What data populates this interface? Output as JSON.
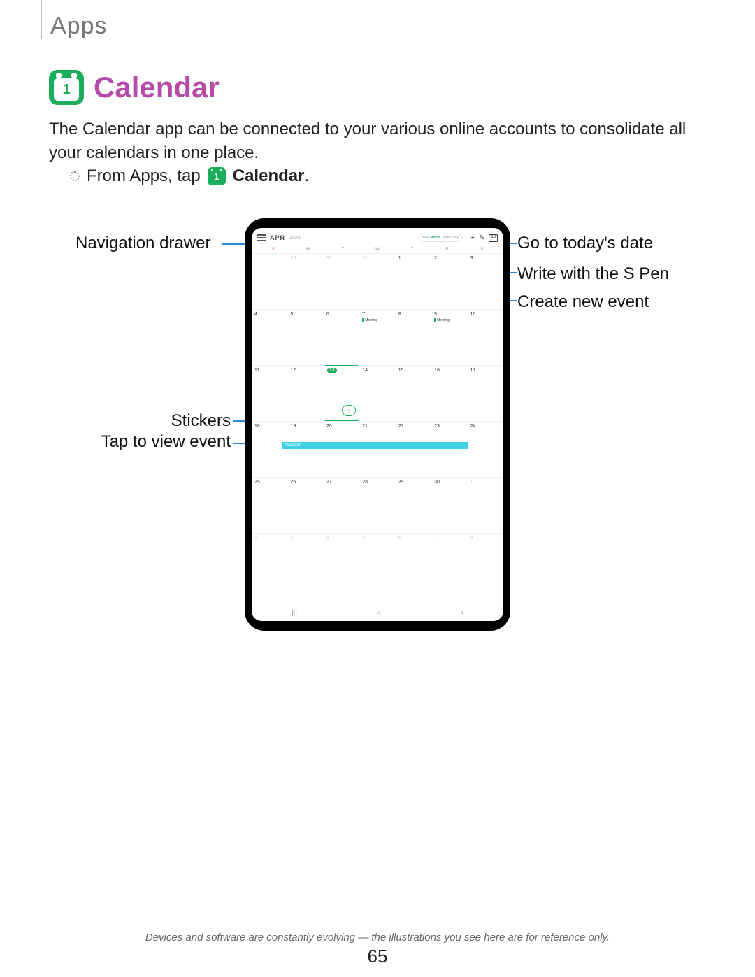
{
  "section": "Apps",
  "title": "Calendar",
  "intro": "The Calendar app can be connected to your various online accounts to consolidate all your calendars in one place.",
  "step_prefix": "From Apps, tap",
  "step_app": "Calendar",
  "step_period": ".",
  "callouts": {
    "nav_drawer": "Navigation drawer",
    "today": "Go to today's date",
    "spen": "Write with the S Pen",
    "new_event": "Create new event",
    "stickers": "Stickers",
    "view_event": "Tap to view event"
  },
  "calendar_screen": {
    "hamburger": "≡",
    "month": "APR",
    "year": "2020",
    "view_tabs": {
      "year": "Year",
      "month": "Month",
      "week": "Week",
      "day": "Day"
    },
    "icons": {
      "plus": "+",
      "pen": "✎",
      "today": "13"
    },
    "dow": [
      "S",
      "M",
      "T",
      "W",
      "T",
      "F",
      "S"
    ],
    "event_label": "Meeting",
    "vacation_label": "Vacation",
    "today_num": "13",
    "cells": [
      {
        "n": "",
        "dim": true
      },
      {
        "n": "29",
        "dim": true
      },
      {
        "n": "30",
        "dim": true
      },
      {
        "n": "31",
        "dim": true
      },
      {
        "n": "1"
      },
      {
        "n": "2"
      },
      {
        "n": "3"
      },
      {
        "n": "4"
      },
      {
        "n": "5"
      },
      {
        "n": "6"
      },
      {
        "n": "7",
        "ev": true
      },
      {
        "n": "8"
      },
      {
        "n": "9",
        "ev": true
      },
      {
        "n": "10"
      },
      {
        "n": "11"
      },
      {
        "n": "12"
      },
      {
        "n": "13",
        "today": true
      },
      {
        "n": "14"
      },
      {
        "n": "15"
      },
      {
        "n": "16"
      },
      {
        "n": "17"
      },
      {
        "n": "18"
      },
      {
        "n": "19"
      },
      {
        "n": "20"
      },
      {
        "n": "21"
      },
      {
        "n": "22"
      },
      {
        "n": "23"
      },
      {
        "n": "24"
      },
      {
        "n": "25"
      },
      {
        "n": "26"
      },
      {
        "n": "27"
      },
      {
        "n": "28"
      },
      {
        "n": "29"
      },
      {
        "n": "30"
      },
      {
        "n": "1",
        "dim": true
      },
      {
        "n": "2",
        "dim": true
      },
      {
        "n": "3",
        "dim": true
      },
      {
        "n": "4",
        "dim": true
      },
      {
        "n": "5",
        "dim": true
      },
      {
        "n": "6",
        "dim": true
      },
      {
        "n": "7",
        "dim": true
      },
      {
        "n": "8",
        "dim": true
      }
    ],
    "nav": {
      "recent": "|||",
      "home": "○",
      "back": "‹"
    }
  },
  "footer": "Devices and software are constantly evolving — the illustrations you see here are for reference only.",
  "page_number": "65"
}
